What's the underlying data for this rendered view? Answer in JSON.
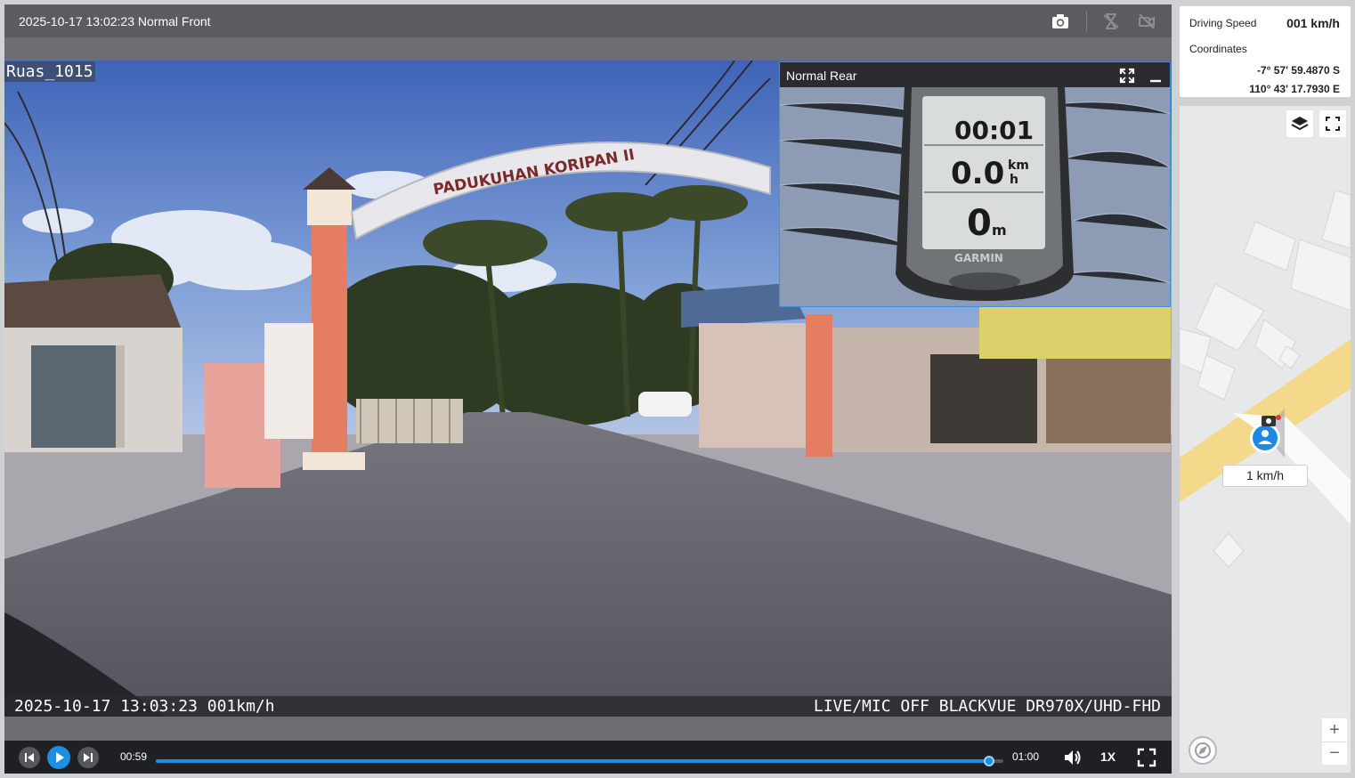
{
  "player": {
    "title": "2025-10-17 13:02:23 Normal Front",
    "overlay_label": "Ruas_1015",
    "osd_left": "2025-10-17 13:03:23 001km/h",
    "osd_right": "LIVE/MIC OFF BLACKVUE DR970X/UHD-FHD",
    "icons": {
      "snapshot": "camera-icon",
      "no_signal_1": "hourglass-off-icon",
      "no_signal_2": "camera-off-icon"
    }
  },
  "scene": {
    "arch_sign": "PADUKUHAN KORIPAN II"
  },
  "pip": {
    "title": "Normal Rear",
    "icons": {
      "expand": "expand-icon",
      "minimize": "minimize-icon"
    },
    "gps_time": "00:01",
    "gps_speed": "0.0",
    "gps_distance": "0",
    "gps_speed_unit_top": "km",
    "gps_speed_unit_bottom": "h",
    "gps_distance_unit": "m",
    "gps_brand": "GARMIN"
  },
  "controls": {
    "time_current": "00:59",
    "time_total": "01:00",
    "progress": 0.983,
    "playback_rate": "1X",
    "icons": {
      "prev": "skip-previous-icon",
      "play": "play-icon",
      "next": "skip-next-icon",
      "volume": "volume-icon",
      "fullscreen": "fullscreen-icon"
    }
  },
  "info": {
    "speed_label": "Driving Speed",
    "speed_value": "001 km/h",
    "coord_label": "Coordinates",
    "latitude": "-7° 57' 59.4870 S",
    "longitude": "110° 43' 17.7930 E"
  },
  "map": {
    "speed_badge": "1 km/h",
    "zoom_in": "+",
    "zoom_out": "−",
    "icons": {
      "layers": "layers-icon",
      "fullscreen": "map-fullscreen-icon",
      "compass": "compass-icon",
      "marker": "vehicle-marker-icon"
    },
    "colors": {
      "road": "#f5d98a",
      "background": "#e6e8e9",
      "marker": "#1e88e5"
    }
  }
}
